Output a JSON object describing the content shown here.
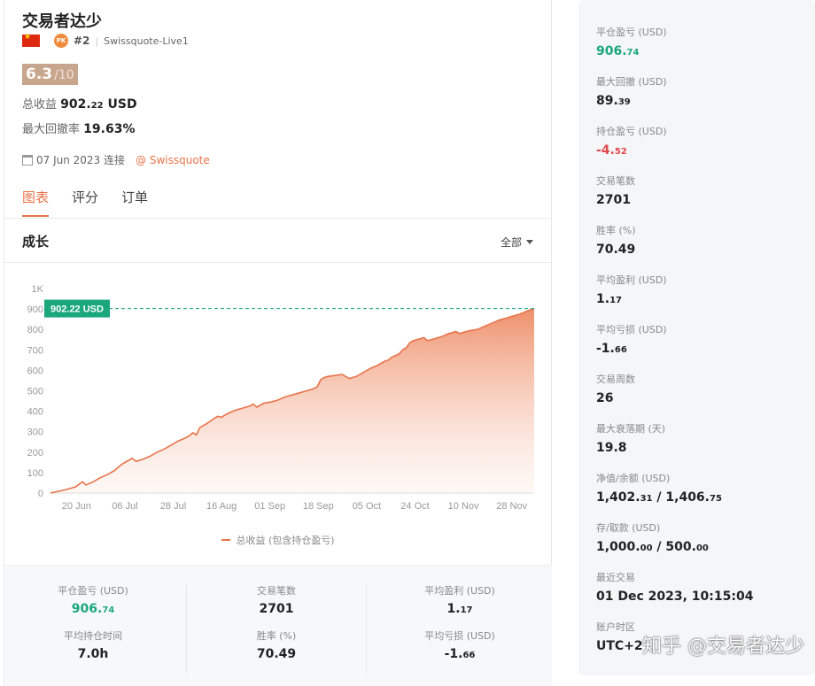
{
  "profile": {
    "name": "交易者达少",
    "pk_label": "PK",
    "rank": "#2",
    "account": "Swissquote-Live1",
    "score": "6.3",
    "score_max": "/10",
    "total_profit_label": "总收益",
    "total_profit_int": "902.",
    "total_profit_dec": "22",
    "total_profit_unit": " USD",
    "max_drawdown_label": "最大回撤率",
    "max_drawdown": "19.63%",
    "connected_date": "07 Jun 2023 连接",
    "broker": "@ Swissquote"
  },
  "tabs": [
    "图表",
    "评分",
    "订单"
  ],
  "growth": {
    "title": "成长",
    "range": "全部",
    "badge": "902.22 USD",
    "legend": "总收益 (包含持仓盈亏)"
  },
  "chart_data": {
    "type": "area",
    "title": "成长",
    "y_ticks": [
      "0",
      "100",
      "200",
      "300",
      "400",
      "500",
      "600",
      "700",
      "800",
      "900",
      "1K"
    ],
    "x_ticks": [
      "20 Jun",
      "06 Jul",
      "28 Jul",
      "16 Aug",
      "01 Sep",
      "18 Sep",
      "05 Oct",
      "24 Oct",
      "10 Nov",
      "28 Nov"
    ],
    "ylim": [
      0,
      1000
    ],
    "current_value": 902.22,
    "series": [
      {
        "name": "总收益 (包含持仓盈亏)",
        "color": "#e8734a",
        "points": [
          [
            0,
            0
          ],
          [
            4,
            15
          ],
          [
            7,
            30
          ],
          [
            9,
            55
          ],
          [
            10,
            40
          ],
          [
            12,
            55
          ],
          [
            14,
            75
          ],
          [
            16,
            90
          ],
          [
            18,
            110
          ],
          [
            20,
            140
          ],
          [
            22,
            160
          ],
          [
            23,
            170
          ],
          [
            24,
            155
          ],
          [
            26,
            165
          ],
          [
            28,
            180
          ],
          [
            30,
            200
          ],
          [
            32,
            215
          ],
          [
            34,
            235
          ],
          [
            36,
            255
          ],
          [
            38,
            270
          ],
          [
            39,
            280
          ],
          [
            40,
            295
          ],
          [
            41,
            285
          ],
          [
            42,
            320
          ],
          [
            44,
            340
          ],
          [
            46,
            365
          ],
          [
            47,
            375
          ],
          [
            48,
            370
          ],
          [
            50,
            390
          ],
          [
            52,
            405
          ],
          [
            54,
            415
          ],
          [
            56,
            425
          ],
          [
            57,
            435
          ],
          [
            58,
            420
          ],
          [
            60,
            440
          ],
          [
            62,
            445
          ],
          [
            64,
            455
          ],
          [
            66,
            470
          ],
          [
            68,
            480
          ],
          [
            70,
            490
          ],
          [
            72,
            500
          ],
          [
            74,
            510
          ],
          [
            75,
            520
          ],
          [
            76,
            555
          ],
          [
            77,
            565
          ],
          [
            78,
            570
          ],
          [
            80,
            575
          ],
          [
            82,
            580
          ],
          [
            83,
            570
          ],
          [
            84,
            560
          ],
          [
            86,
            570
          ],
          [
            88,
            590
          ],
          [
            90,
            610
          ],
          [
            92,
            625
          ],
          [
            94,
            645
          ],
          [
            95,
            650
          ],
          [
            96,
            665
          ],
          [
            98,
            680
          ],
          [
            99,
            700
          ],
          [
            100,
            710
          ],
          [
            101,
            735
          ],
          [
            102,
            745
          ],
          [
            104,
            755
          ],
          [
            105,
            760
          ],
          [
            106,
            745
          ],
          [
            108,
            755
          ],
          [
            110,
            765
          ],
          [
            112,
            780
          ],
          [
            114,
            790
          ],
          [
            115,
            780
          ],
          [
            116,
            785
          ],
          [
            118,
            795
          ],
          [
            120,
            800
          ],
          [
            122,
            815
          ],
          [
            124,
            830
          ],
          [
            126,
            845
          ],
          [
            128,
            855
          ],
          [
            130,
            865
          ],
          [
            132,
            875
          ],
          [
            134,
            890
          ],
          [
            136,
            902.22
          ]
        ]
      }
    ]
  },
  "bottom_stats": [
    {
      "label": "平仓盈亏 (USD)",
      "int": "906.",
      "dec": "74",
      "color": "green"
    },
    {
      "label": "平均持仓时间",
      "int": "7.0h",
      "dec": "",
      "color": ""
    },
    {
      "label": "交易笔数",
      "int": "2701",
      "dec": "",
      "color": ""
    },
    {
      "label": "胜率 (%)",
      "int": "70.49",
      "dec": "",
      "color": ""
    },
    {
      "label": "平均盈利 (USD)",
      "int": "1.",
      "dec": "17",
      "color": ""
    },
    {
      "label": "平均亏损 (USD)",
      "int": "-1.",
      "dec": "66",
      "color": ""
    }
  ],
  "right_stats": [
    {
      "label": "平仓盈亏 (USD)",
      "int": "906.",
      "dec": "74",
      "color": "green"
    },
    {
      "label": "最大回撤 (USD)",
      "int": "89.",
      "dec": "39",
      "color": ""
    },
    {
      "label": "持仓盈亏 (USD)",
      "int": "-4.",
      "dec": "52",
      "color": "red"
    },
    {
      "label": "交易笔数",
      "int": "2701",
      "dec": "",
      "color": ""
    },
    {
      "label": "胜率 (%)",
      "int": "70.49",
      "dec": "",
      "color": ""
    },
    {
      "label": "平均盈利 (USD)",
      "int": "1.",
      "dec": "17",
      "color": ""
    },
    {
      "label": "平均亏损 (USD)",
      "int": "-1.",
      "dec": "66",
      "color": ""
    },
    {
      "label": "交易周数",
      "int": "26",
      "dec": "",
      "color": ""
    },
    {
      "label": "最大衰落期 (天)",
      "int": "19.8",
      "dec": "",
      "color": ""
    },
    {
      "label": "净值/余额 (USD)",
      "int": "1,402.",
      "dec": "31",
      "int2": " / 1,406.",
      "dec2": "75",
      "color": ""
    },
    {
      "label": "存/取款 (USD)",
      "int": "1,000.",
      "dec": "00",
      "int2": " / 500.",
      "dec2": "00",
      "color": ""
    },
    {
      "label": "最近交易",
      "int": "01 Dec 2023, 10:15:04",
      "dec": "",
      "color": ""
    },
    {
      "label": "账户时区",
      "int": "UTC+2",
      "dec": "",
      "color": ""
    }
  ],
  "watermark": "知乎 @交易者达少"
}
